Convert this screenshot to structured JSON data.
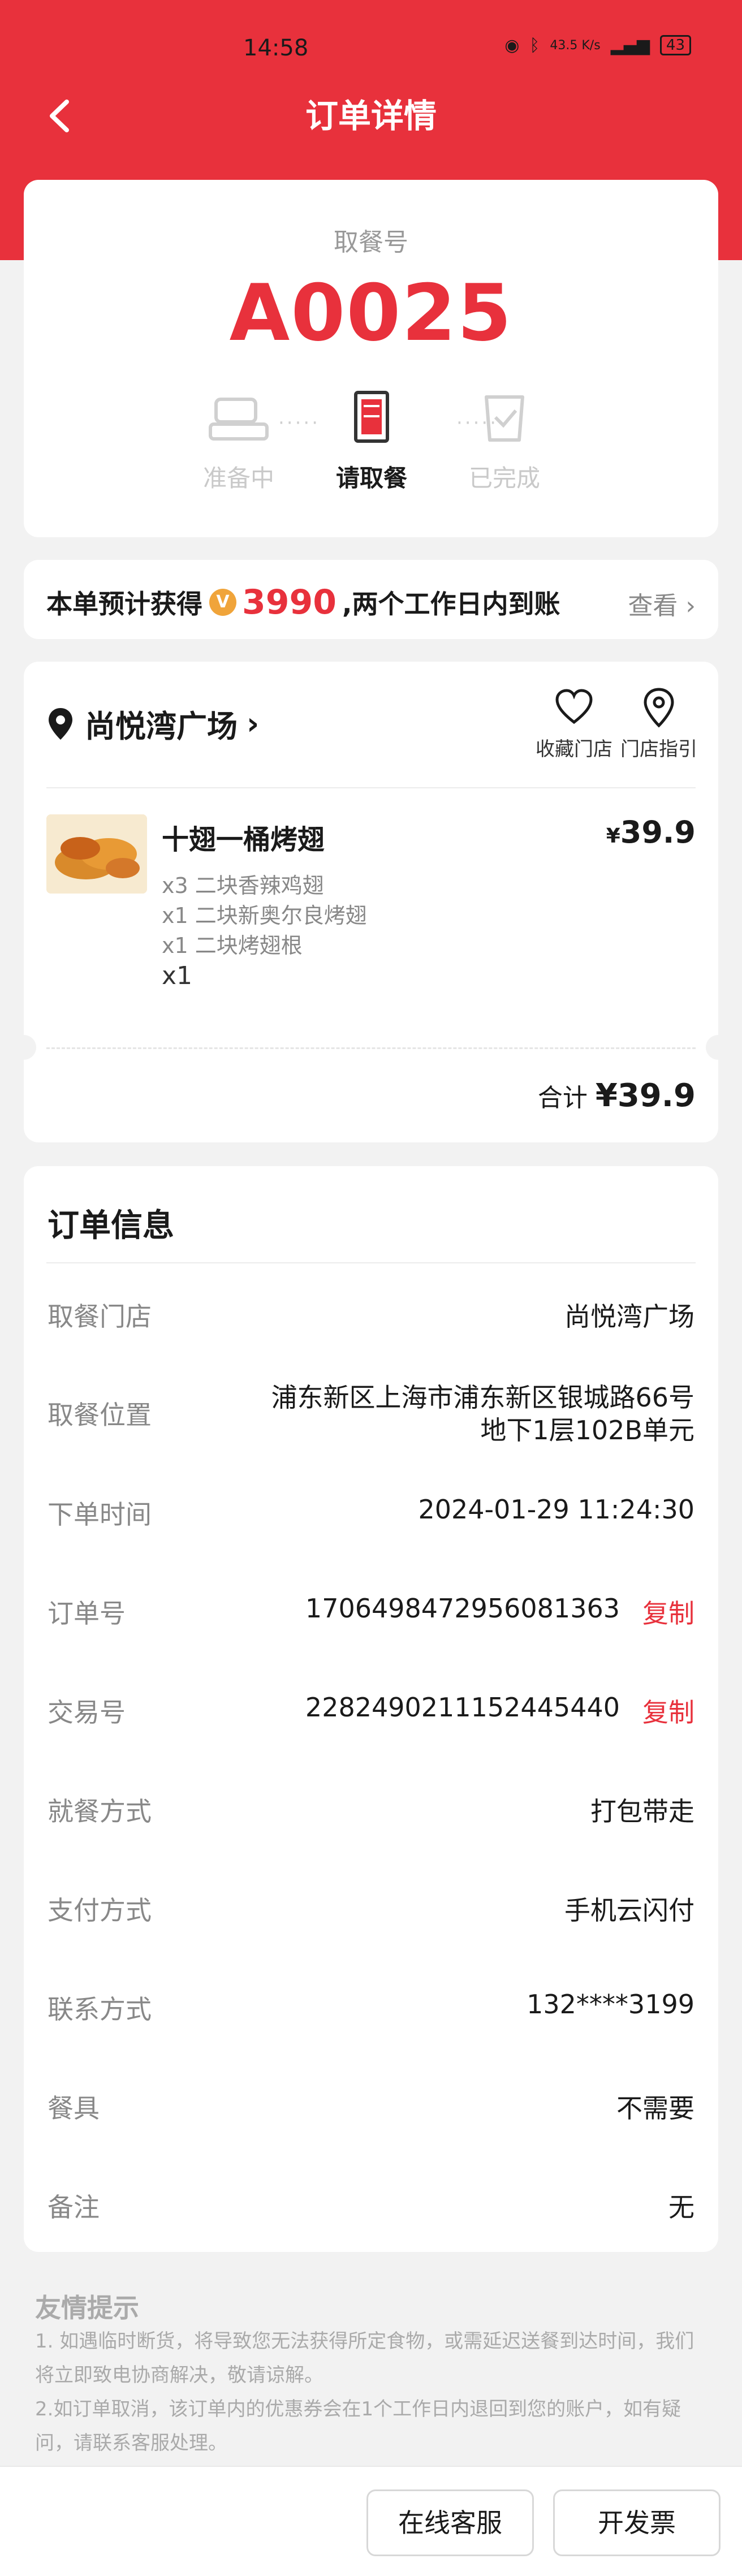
{
  "status_bar": {
    "time": "14:58",
    "speed": "43.5 K/s",
    "battery": "43"
  },
  "nav": {
    "title": "订单详情"
  },
  "pickup": {
    "label": "取餐号",
    "number": "A0025",
    "steps": [
      {
        "label": "准备中",
        "active": false
      },
      {
        "label": "请取餐",
        "active": true
      },
      {
        "label": "已完成",
        "active": false
      }
    ]
  },
  "earn": {
    "prefix": "本单预计获得",
    "coin": "V",
    "points": "3990",
    "suffix": ",两个工作日内到账",
    "view": "查看"
  },
  "store": {
    "name": "尚悦湾广场",
    "fav_label": "收藏门店",
    "guide_label": "门店指引"
  },
  "item": {
    "name": "十翅一桶烤翅",
    "price_symbol": "¥",
    "price": "39.9",
    "subs": [
      "x3 二块香辣鸡翅",
      "x1 二块新奥尔良烤翅",
      "x1 二块烤翅根"
    ],
    "qty": "x1"
  },
  "total": {
    "label": "合计",
    "value": "¥39.9"
  },
  "order_info": {
    "title": "订单信息",
    "rows": [
      {
        "key": "取餐门店",
        "value": "尚悦湾广场"
      },
      {
        "key": "取餐位置",
        "value": "浦东新区上海市浦东新区银城路66号",
        "value2": "地下1层102B单元"
      },
      {
        "key": "下单时间",
        "value": "2024-01-29 11:24:30"
      },
      {
        "key": "订单号",
        "value": "1706498472956081363",
        "copy": "复制"
      },
      {
        "key": "交易号",
        "value": "2282490211152445440",
        "copy": "复制"
      },
      {
        "key": "就餐方式",
        "value": "打包带走"
      },
      {
        "key": "支付方式",
        "value": "手机云闪付"
      },
      {
        "key": "联系方式",
        "value": "132****3199"
      },
      {
        "key": "餐具",
        "value": "不需要"
      },
      {
        "key": "备注",
        "value": "无"
      }
    ]
  },
  "tips": {
    "title": "友情提示",
    "lines": [
      "1. 如遇临时断货，将导致您无法获得所定食物，或需延迟送餐到达时间，我们将立即致电协商解决，敬请谅解。",
      "2.如订单取消，该订单内的优惠券会在1个工作日内退回到您的账户，如有疑问，请联系客服处理。"
    ]
  },
  "buttons": {
    "service": "在线客服",
    "invoice": "开发票"
  },
  "colors": {
    "brand": "#e8313c",
    "coin": "#f0a43a"
  }
}
